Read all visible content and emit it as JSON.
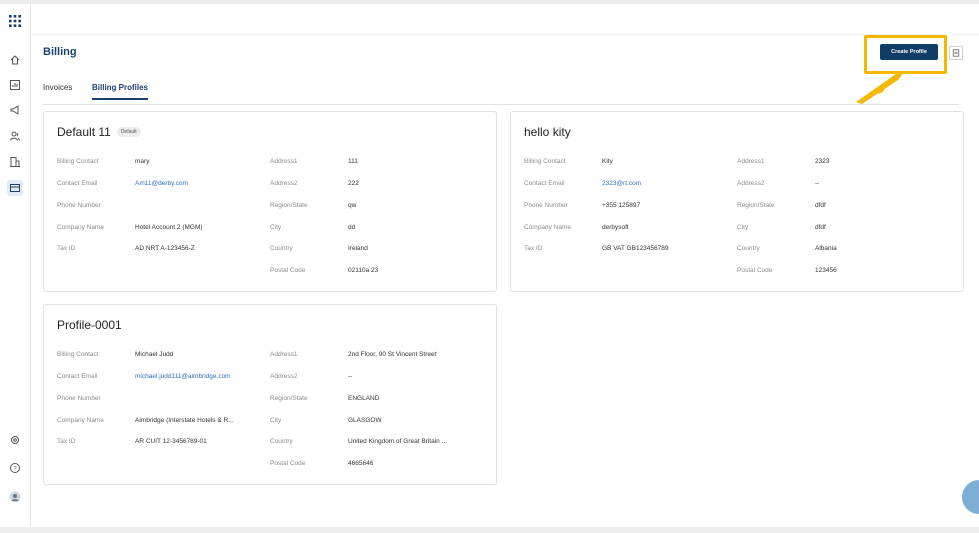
{
  "page": {
    "title": "Billing",
    "tabs": [
      "Invoices",
      "Billing Profiles"
    ],
    "active_tab": "Billing Profiles",
    "create_button": "Create Profile"
  },
  "labels": {
    "billing_contact": "Billing Contact",
    "contact_email": "Contact Email",
    "phone_number": "Phone Number",
    "company_name": "Company Name",
    "tax_id": "Tax ID",
    "address1": "Address1",
    "address2": "Address2",
    "region_state": "Region/State",
    "city": "City",
    "country": "Country",
    "postal_code": "Postal Code"
  },
  "profiles": [
    {
      "name": "Default 11",
      "badge": "Default",
      "billing_contact": "mary",
      "contact_email": "Am11@derby.com",
      "phone_number": "",
      "company_name": "Hotel Account 2 (MGM)",
      "tax_id": "AD NRT A-123456-Z",
      "address1": "111",
      "address2": "222",
      "region_state": "qw",
      "city": "dd",
      "country": "Ireland",
      "postal_code": "02110a 23"
    },
    {
      "name": "hello kity",
      "billing_contact": "Kity",
      "contact_email": "2323@rt.com",
      "phone_number": "+355 125897",
      "company_name": "derbysoft",
      "tax_id": "GB VAT GB123456789",
      "address1": "2323",
      "address2": "--",
      "region_state": "dfdf",
      "city": "dfdf",
      "country": "Albania",
      "postal_code": "123456"
    },
    {
      "name": "Profile-0001",
      "billing_contact": "Michael Judd",
      "contact_email": "michael.judd111@aimbridge.com",
      "phone_number": "",
      "company_name": "Aimbridge (Interstate Hotels & R...",
      "tax_id": "AR CUIT 12-3456789-01",
      "address1": "2nd Floor, 90 St Vincent Street",
      "address2": "--",
      "region_state": "ENGLAND",
      "city": "GLASGOW",
      "country": "United Kingdom of Great Britain ...",
      "postal_code": "4665646"
    }
  ],
  "icons": {
    "sidebar": [
      "apps-grid-icon",
      "home-icon",
      "report-icon",
      "campaign-icon",
      "users-icon",
      "hotel-icon",
      "billing-icon",
      "settings-icon",
      "help-icon",
      "user-avatar"
    ],
    "header": [
      "document-icon"
    ]
  },
  "colors": {
    "primary": "#123d66",
    "title": "#1d3f6e",
    "link": "#2d6fc2",
    "highlight": "#f5b800"
  }
}
